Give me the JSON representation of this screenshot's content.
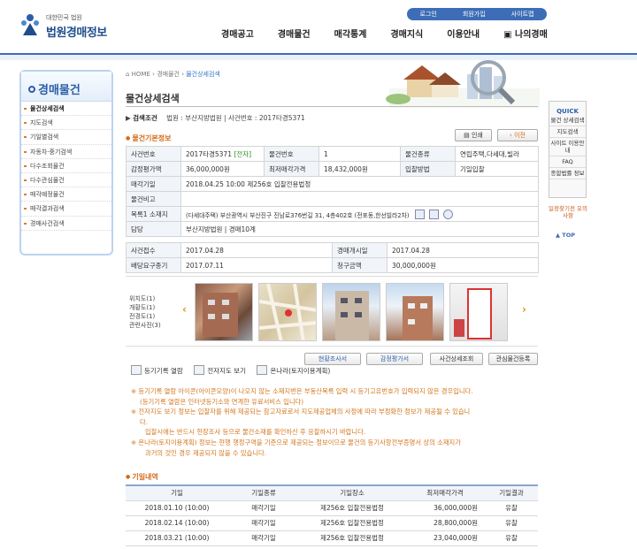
{
  "header": {
    "logo_small": "대한민국 법원",
    "logo_big": "법원경매정보",
    "util": [
      "로그인",
      "회원가입",
      "사이트맵"
    ],
    "gnb": [
      "경매공고",
      "경매물건",
      "매각통계",
      "경매지식",
      "이용안내",
      "나의경매"
    ]
  },
  "lnb": {
    "title": "경매물건",
    "items": [
      "물건상세검색",
      "지도검색",
      "기일별검색",
      "자동차·중기검색",
      "다수조회물건",
      "다수관심물건",
      "매각예정물건",
      "매각결과검색",
      "경매사건검색"
    ],
    "active_index": 0
  },
  "quick": {
    "title": "QUICK",
    "items": [
      "물건 상세검색",
      "지도검색",
      "사이트 이용안내",
      "FAQ",
      "종합법률 정보"
    ],
    "extra": "일정찾기전 유의사항",
    "top": "TOP"
  },
  "breadcrumb": {
    "home": "HOME",
    "level1": "경매물건",
    "current": "물건상세검색"
  },
  "page_title": "물건상세검색",
  "condition": {
    "label": "검색조건",
    "text": "법원 : 부산지방법원 | 사건번호 : 2017타경5371"
  },
  "section_basic": "물건기본정보",
  "buttons": {
    "print": "인쇄",
    "prev": "이전"
  },
  "basic_info": {
    "case_no_label": "사건번호",
    "case_no": "2017타경5371",
    "case_tag": "[전자]",
    "item_no_label": "물건번호",
    "item_no": "1",
    "item_type_label": "물건종류",
    "item_type": "연립주택,다세대,빌라",
    "appraisal_label": "감정평가액",
    "appraisal": "36,000,000원",
    "min_price_label": "최저매각가격",
    "min_price": "18,432,000원",
    "bid_method_label": "입찰방법",
    "bid_method": "기일입찰",
    "sale_date_label": "매각기일",
    "sale_date": "2018.04.25 10:00 제256호 입찰전용법정",
    "note_label": "물건비고",
    "note": "",
    "list_label": "목록1 소재지",
    "list_value": "(다세대주택) 부산광역시 부산진구 진남로376번길 31, 4층402호 (전포동,한선빌라2차)",
    "dept_label": "담당",
    "dept": "부산지방법원 | 경매10계"
  },
  "case_info": {
    "receipt_label": "사건접수",
    "receipt": "2017.04.28",
    "start_label": "경매개시일",
    "start": "2017.04.28",
    "dividend_label": "배당요구종기",
    "dividend": "2017.07.11",
    "claim_label": "청구금액",
    "claim": "30,000,000원"
  },
  "photos": {
    "labels": [
      "위치도(1)",
      "개황도(1)",
      "전경도(1)",
      "관련사진(3)"
    ]
  },
  "photo_buttons": [
    "현황조사서",
    "감정평가서",
    "사건상세조회",
    "관심물건등록"
  ],
  "links": [
    "등기기록 열람",
    "전자지도 보기",
    "온나라(토지이용계획)"
  ],
  "notes": [
    "※ 등기기록 열람 아이콘(아이콘모양)이 나오지 않는 소재지번은 부동산목록 입력 시 등기고유번호가 입력되지 않은 경우입니다.",
    "(등기기록 열람은 인터넷등기소와 연계한 유료서비스 입니다)",
    "※ 전자지도 보기 정보는 입찰자를 위해 제공되는 참고자료로서 지도제공업체의 사정에 따라 부정확한 정보가 제공될 수 있습니",
    "다.",
    "입찰시에는 반드시 현장조사 등으로 물건소재를 확인하신 후 응찰하시기 바랍니다.",
    "※ 온나라(토지이용계획) 정보는 현행 행정구역을 기준으로 제공되는 정보이므로 물건의 등기사항전부증명서 상의 소재지가",
    "과거의 것인 경우 제공되지 않을 수 있습니다."
  ],
  "section_history": "기일내역",
  "history": {
    "headers": [
      "기일",
      "기일종류",
      "기일장소",
      "최저매각가격",
      "기일결과"
    ],
    "rows": [
      [
        "2018.01.10 (10:00)",
        "매각기일",
        "제256호 입찰전용법정",
        "36,000,000원",
        "유찰"
      ],
      [
        "2018.02.14 (10:00)",
        "매각기일",
        "제256호 입찰전용법정",
        "28,800,000원",
        "유찰"
      ],
      [
        "2018.03.21 (10:00)",
        "매각기일",
        "제256호 입찰전용법정",
        "23,040,000원",
        "유찰"
      ]
    ]
  },
  "colors": {
    "brand": "#3d6db6",
    "accent": "#d46a1a"
  }
}
